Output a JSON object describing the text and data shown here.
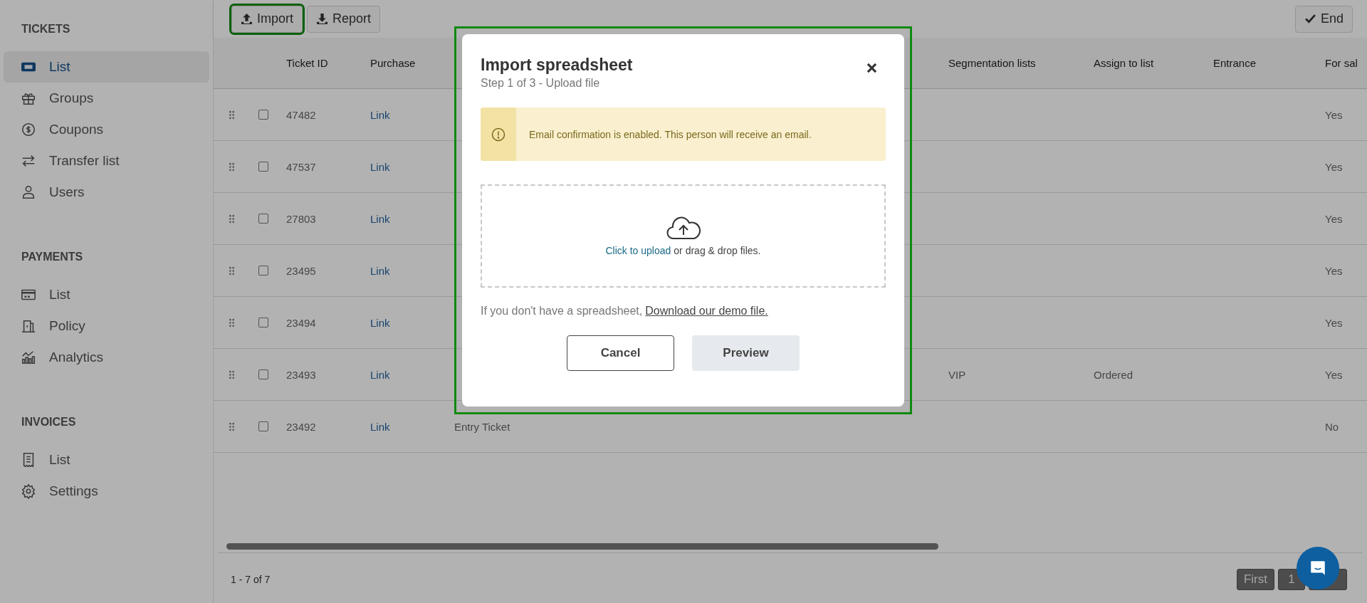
{
  "toolbar": {
    "buttons": [
      {
        "label": "Import",
        "highlighted": true
      },
      {
        "label": "Report",
        "highlighted": false
      }
    ],
    "end_button": "End"
  },
  "sidebar": {
    "sections": [
      {
        "title": "TICKETS",
        "items": [
          {
            "label": "List",
            "selected": true
          },
          {
            "label": "Groups",
            "selected": false
          },
          {
            "label": "Coupons",
            "selected": false
          },
          {
            "label": "Transfer list",
            "selected": false
          },
          {
            "label": "Users",
            "selected": false
          }
        ]
      },
      {
        "title": "PAYMENTS",
        "items": [
          {
            "label": "List",
            "selected": false
          },
          {
            "label": "Policy",
            "selected": false
          },
          {
            "label": "Analytics",
            "selected": false
          }
        ]
      },
      {
        "title": "INVOICES",
        "items": [
          {
            "label": "List",
            "selected": false
          },
          {
            "label": "Settings",
            "selected": false
          }
        ]
      }
    ]
  },
  "table": {
    "columns": [
      "Ticket ID",
      "Purchase",
      "Segmentation lists",
      "Assign to list",
      "Entrance",
      "For sal"
    ],
    "rows": [
      {
        "checked": false,
        "ticket_id": "47482",
        "purchase": "Link",
        "for_sale": "Yes"
      },
      {
        "checked": false,
        "ticket_id": "47537",
        "purchase": "Link",
        "for_sale": "Yes"
      },
      {
        "checked": false,
        "ticket_id": "27803",
        "purchase": "Link",
        "for_sale": "Yes"
      },
      {
        "checked": false,
        "ticket_id": "23495",
        "purchase": "Link",
        "for_sale": "Yes"
      },
      {
        "checked": false,
        "ticket_id": "23494",
        "purchase": "Link",
        "for_sale": "Yes"
      },
      {
        "checked": false,
        "ticket_id": "23493",
        "purchase": "Link",
        "segmentation": "VIP",
        "assign": "Ordered",
        "for_sale": "Yes"
      },
      {
        "checked": false,
        "ticket_id": "23492",
        "purchase": "Link",
        "name": "Entry Ticket",
        "for_sale": "No"
      }
    ]
  },
  "footer": {
    "range": "1 - 7 of 7",
    "pages": [
      "First",
      "1"
    ]
  },
  "modal": {
    "highlighted": true,
    "title": "Import spreadsheet",
    "subtitle": "Step 1 of 3 - Upload file",
    "alert": "Email confirmation is enabled. This person will receive an email.",
    "upload_link": "Click to upload",
    "upload_text": "or drag & drop files.",
    "hint": "If you don't have a spreadsheet,",
    "hint_link": "Download our demo file.",
    "cancel": "Cancel",
    "preview": "Preview"
  }
}
